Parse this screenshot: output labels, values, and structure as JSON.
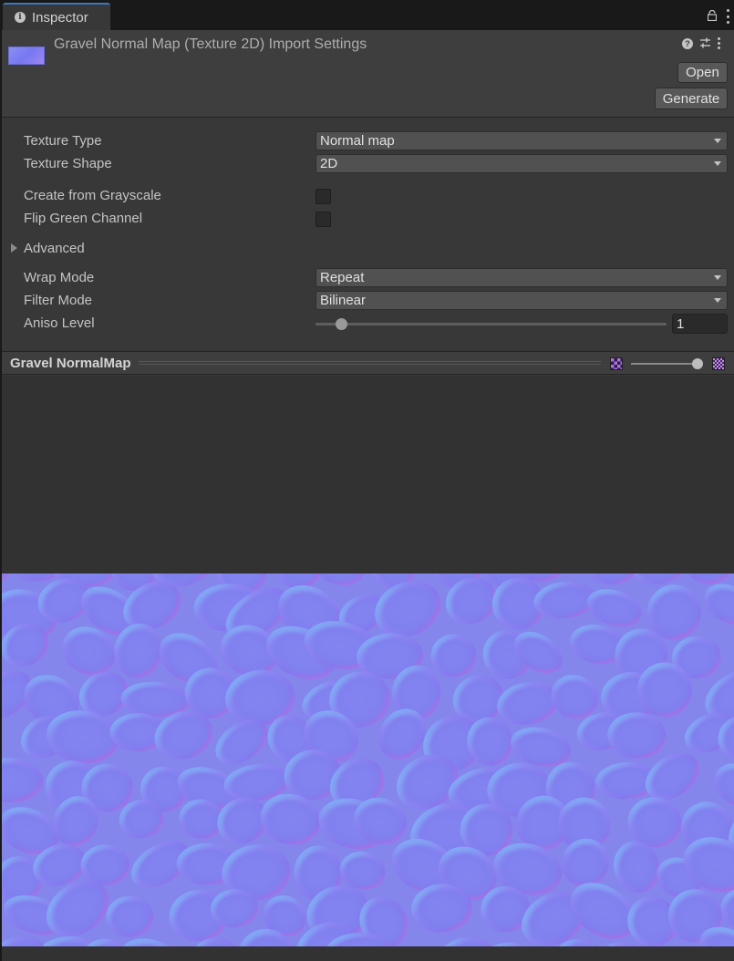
{
  "tab": {
    "label": "Inspector",
    "icon": "info-icon"
  },
  "header": {
    "title": "Gravel Normal Map (Texture 2D) Import Settings",
    "open_label": "Open",
    "generate_label": "Generate"
  },
  "fields": {
    "texture_type": {
      "label": "Texture Type",
      "value": "Normal map"
    },
    "texture_shape": {
      "label": "Texture Shape",
      "value": "2D"
    },
    "create_from_grayscale": {
      "label": "Create from Grayscale",
      "checked": false
    },
    "flip_green_channel": {
      "label": "Flip Green Channel",
      "checked": false
    },
    "advanced": {
      "label": "Advanced",
      "expanded": false
    },
    "wrap_mode": {
      "label": "Wrap Mode",
      "value": "Repeat"
    },
    "filter_mode": {
      "label": "Filter Mode",
      "value": "Bilinear"
    },
    "aniso_level": {
      "label": "Aniso Level",
      "value": "1",
      "slider_fraction": 0.06
    }
  },
  "preview": {
    "title": "Gravel NormalMap",
    "mip_slider_fraction": 1.0
  },
  "colors": {
    "accent": "#3a79bb",
    "normal_base": "#7f7ff0"
  }
}
